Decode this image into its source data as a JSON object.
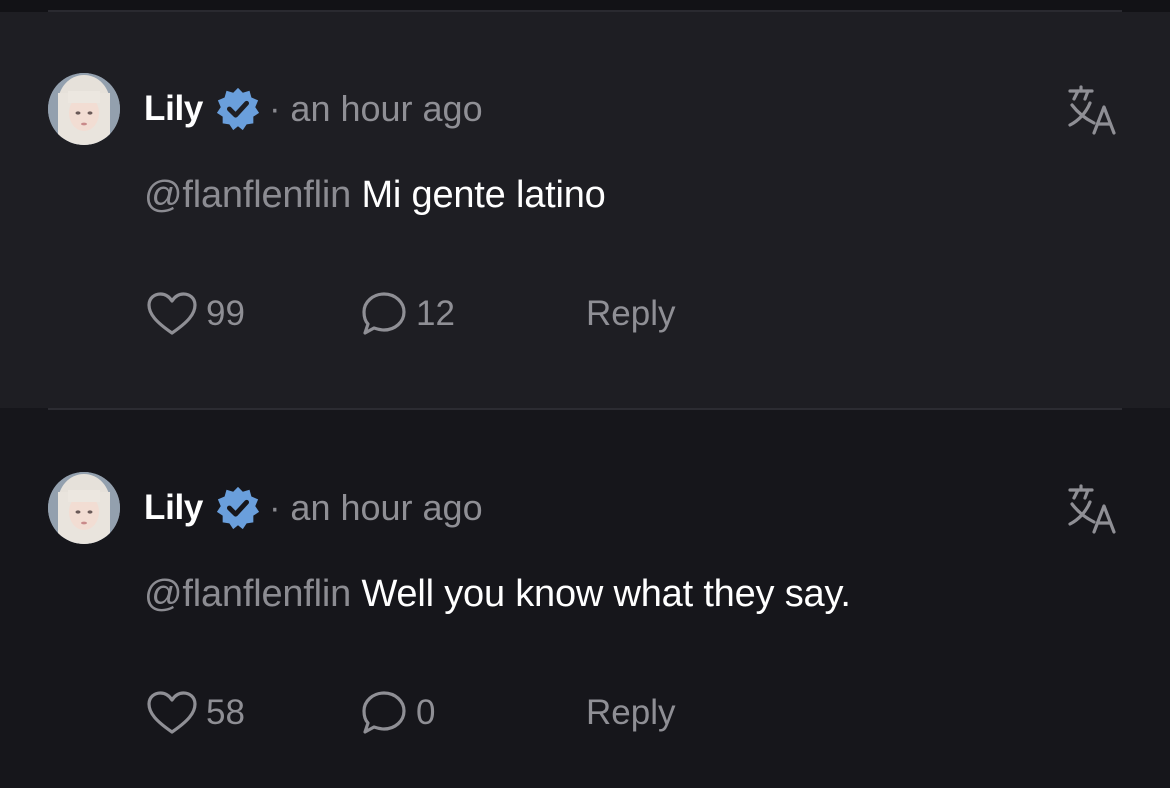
{
  "comments": [
    {
      "author": "Lily",
      "separator": "·",
      "time": "an hour ago",
      "mention": "@flanflenflin",
      "text": "Mi gente latino",
      "likes": "99",
      "replies": "12",
      "reply_label": "Reply"
    },
    {
      "author": "Lily",
      "separator": "·",
      "time": "an hour ago",
      "mention": "@flanflenflin",
      "text": "Well you know what they say.",
      "likes": "58",
      "replies": "0",
      "reply_label": "Reply"
    }
  ],
  "icons": {
    "verified": "verified-badge-icon",
    "translate": "translate-icon",
    "like": "heart-icon",
    "comments": "speech-bubble-icon"
  },
  "colors": {
    "verified_blue": "#6a9fdc",
    "muted_text": "#8f8f95",
    "primary_text": "#ffffff",
    "card_bg": "#1e1e23",
    "page_bg": "#16161b"
  }
}
